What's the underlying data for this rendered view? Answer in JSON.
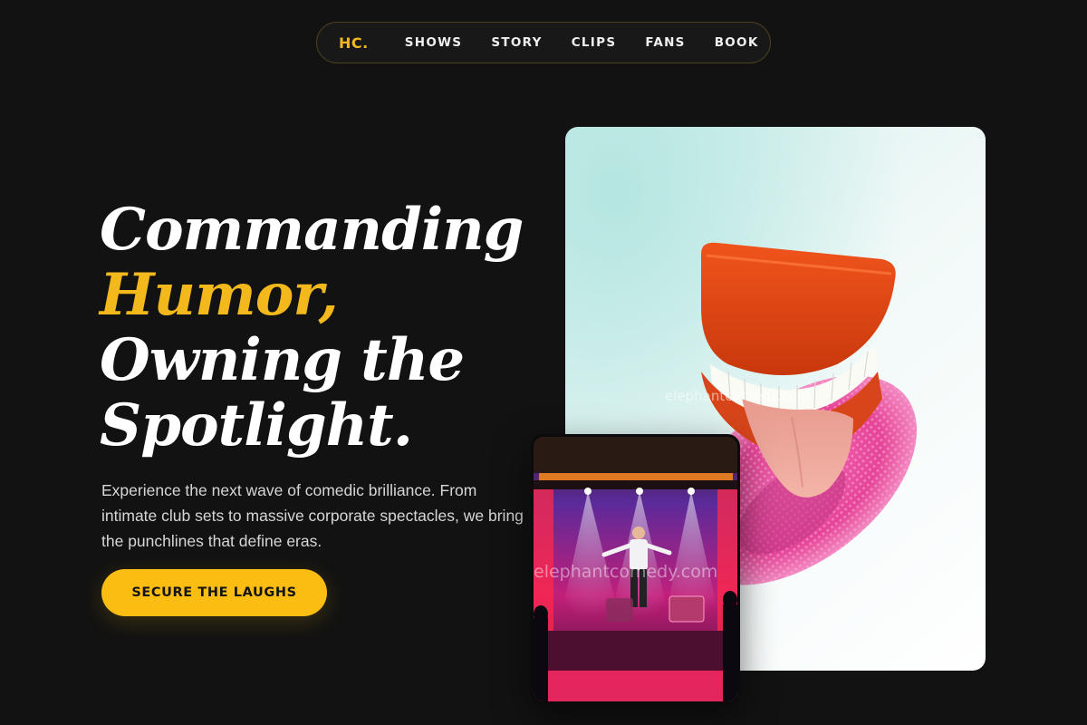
{
  "nav": {
    "logo": "HC.",
    "links": [
      "SHOWS",
      "STORY",
      "CLIPS",
      "FANS",
      "BOOK"
    ]
  },
  "hero": {
    "headline_line1": "Commanding",
    "headline_accent": "Humor,",
    "headline_line3": "Owning the",
    "headline_line4": "Spotlight.",
    "subcopy": "Experience the next wave of comedic brilliance. From intimate club sets to massive corporate spectacles, we bring the punchlines that define eras.",
    "cta_label": "SECURE THE LAUGHS"
  },
  "images": {
    "main_watermark": "elephantcomedy.com",
    "stage_watermark": "elephantcomedy.com"
  },
  "colors": {
    "background": "#121212",
    "accent": "#f3b81c",
    "cta": "#fbbd12",
    "nav_border": "#4a4120"
  }
}
